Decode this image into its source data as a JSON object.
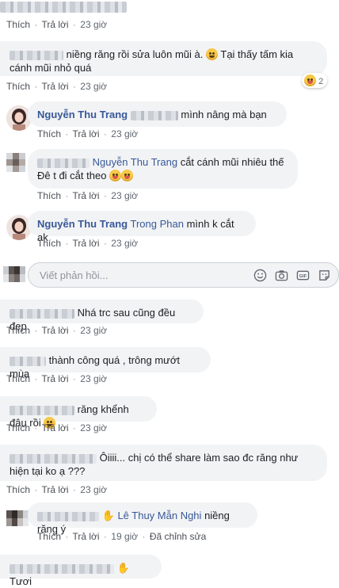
{
  "actions": {
    "like": "Thích",
    "reply": "Trả lời",
    "separator": "·"
  },
  "comments": [
    {
      "time": "23 giờ"
    },
    {
      "text": "niềng răng rồi sửa luôn mũi à.",
      "text2": "Tại thấy tấm kia cánh mũi nhỏ quá",
      "time": "23 giờ",
      "reaction_count": "2"
    },
    {
      "author": "Nguyễn Thu Trang",
      "text": "mình nâng mà bạn",
      "time": "23 giờ"
    },
    {
      "tag": "Nguyễn Thu Trang",
      "text": "cắt cánh mũi nhiêu thế",
      "text2": "Đê t đi cắt theo",
      "time": "23 giờ"
    },
    {
      "author": "Nguyễn Thu Trang",
      "tag": "Trong Phan",
      "text": "mình k cắt ak",
      "time": "23 giờ"
    },
    {
      "text": "Nhá trc sau cũng đều đẹp",
      "time": "23 giờ"
    },
    {
      "text": "thành công quá , trông mướt mùa",
      "time": "23 giờ"
    },
    {
      "text": "răng khểnh đâu rồi",
      "time": "23 giờ"
    },
    {
      "text": "Ôiiii... chị có thể share làm sao đc răng như hiện tại ko ạ ???",
      "time": "23 giờ"
    },
    {
      "tag": "Lê Thuy Mẫn Nghi",
      "text": "niềng răng ý",
      "time": "19 giờ",
      "edited": "Đã chỉnh sửa"
    },
    {
      "text": "Tươi"
    }
  ],
  "reply_box": {
    "placeholder": "Viết phản hồi..."
  },
  "colors": {
    "link": "#385898",
    "bubble": "#f2f3f5",
    "meta": "#606770"
  }
}
